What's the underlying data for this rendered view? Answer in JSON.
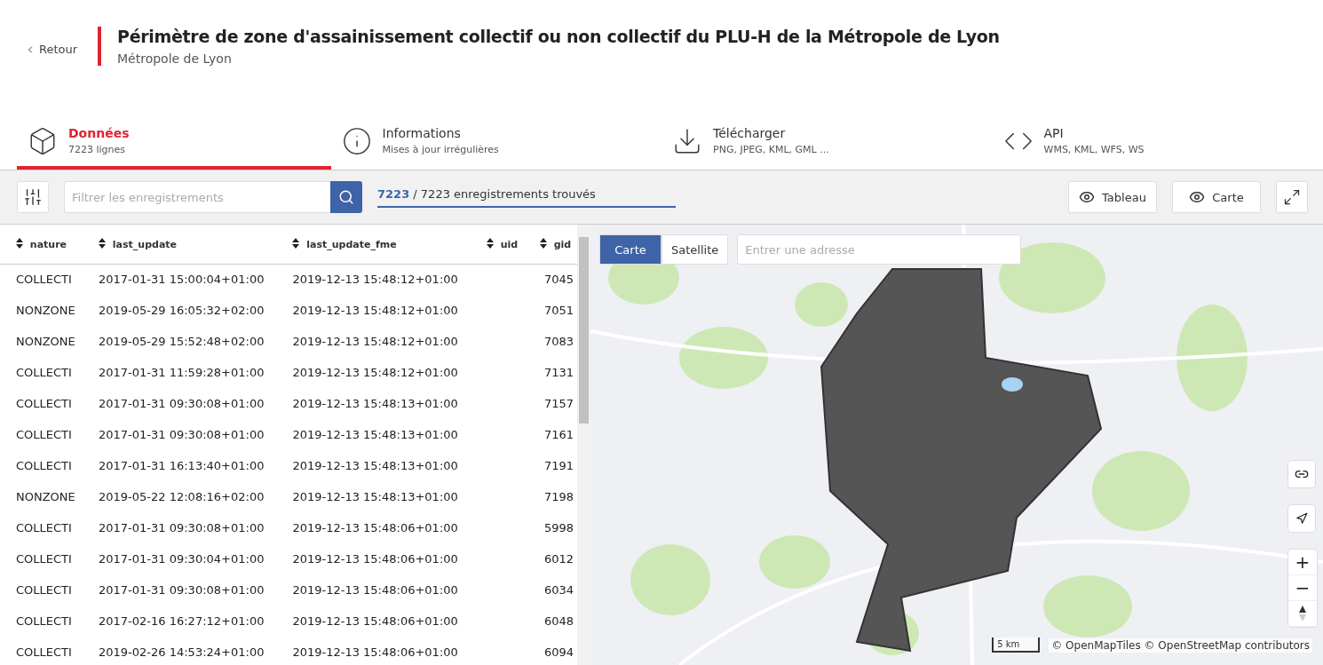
{
  "header": {
    "back": "Retour",
    "title": "Périmètre de zone d'assainissement collectif ou non collectif du PLU-H de la Métropole de Lyon",
    "subtitle": "Métropole de Lyon"
  },
  "tabs": [
    {
      "kind": "cube",
      "label": "Données",
      "sub": "7223 lignes",
      "selected": true
    },
    {
      "kind": "info",
      "label": "Informations",
      "sub": "Mises à jour irrégulières",
      "selected": false
    },
    {
      "kind": "download",
      "label": "Télécharger",
      "sub": "PNG, JPEG, KML, GML ...",
      "selected": false
    },
    {
      "kind": "code",
      "label": "API",
      "sub": "WMS, KML, WFS, WS",
      "selected": false
    }
  ],
  "toolbar": {
    "search_placeholder": "Filtrer les enregistrements",
    "count": "7223",
    "count_rest": "/ 7223 enregistrements trouvés",
    "views": [
      "Tableau",
      "Carte"
    ]
  },
  "table": {
    "columns": [
      "nature",
      "last_update",
      "last_update_fme",
      "uid",
      "gid"
    ],
    "rows": [
      [
        "COLLECTI",
        "2017-01-31 15:00:04+01:00",
        "2019-12-13 15:48:12+01:00",
        "",
        "7045"
      ],
      [
        "NONZONE",
        "2019-05-29 16:05:32+02:00",
        "2019-12-13 15:48:12+01:00",
        "",
        "7051"
      ],
      [
        "NONZONE",
        "2019-05-29 15:52:48+02:00",
        "2019-12-13 15:48:12+01:00",
        "",
        "7083"
      ],
      [
        "COLLECTI",
        "2017-01-31 11:59:28+01:00",
        "2019-12-13 15:48:12+01:00",
        "",
        "7131"
      ],
      [
        "COLLECTI",
        "2017-01-31 09:30:08+01:00",
        "2019-12-13 15:48:13+01:00",
        "",
        "7157"
      ],
      [
        "COLLECTI",
        "2017-01-31 09:30:08+01:00",
        "2019-12-13 15:48:13+01:00",
        "",
        "7161"
      ],
      [
        "COLLECTI",
        "2017-01-31 16:13:40+01:00",
        "2019-12-13 15:48:13+01:00",
        "",
        "7191"
      ],
      [
        "NONZONE",
        "2019-05-22 12:08:16+02:00",
        "2019-12-13 15:48:13+01:00",
        "",
        "7198"
      ],
      [
        "COLLECTI",
        "2017-01-31 09:30:08+01:00",
        "2019-12-13 15:48:06+01:00",
        "",
        "5998"
      ],
      [
        "COLLECTI",
        "2017-01-31 09:30:04+01:00",
        "2019-12-13 15:48:06+01:00",
        "",
        "6012"
      ],
      [
        "COLLECTI",
        "2017-01-31 09:30:08+01:00",
        "2019-12-13 15:48:06+01:00",
        "",
        "6034"
      ],
      [
        "COLLECTI",
        "2017-02-16 16:27:12+01:00",
        "2019-12-13 15:48:06+01:00",
        "",
        "6048"
      ],
      [
        "COLLECTI",
        "2019-02-26 14:53:24+01:00",
        "2019-12-13 15:48:06+01:00",
        "",
        "6094"
      ]
    ]
  },
  "map": {
    "modes": [
      {
        "label": "Carte",
        "selected": true
      },
      {
        "label": "Satellite",
        "selected": false
      }
    ],
    "address_placeholder": "Entrer une adresse",
    "zoom_in": "+",
    "zoom_out": "−",
    "scale": "5 km",
    "attribution": "© OpenMapTiles © OpenStreetMap contributors"
  }
}
